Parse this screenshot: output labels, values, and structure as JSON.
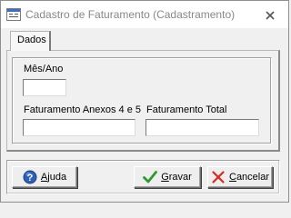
{
  "window": {
    "title": "Cadastro de Faturamento (Cadastramento)"
  },
  "tabs": [
    {
      "label": "Dados",
      "active": true
    }
  ],
  "form": {
    "mes_ano": {
      "label": "Mês/Ano",
      "value": ""
    },
    "faturamento_anexos": {
      "label": "Faturamento Anexos 4 e 5",
      "value": ""
    },
    "faturamento_total": {
      "label": "Faturamento Total",
      "value": ""
    }
  },
  "buttons": {
    "ajuda": {
      "accel": "A",
      "rest": "juda",
      "icon": "help-icon"
    },
    "gravar": {
      "accel": "G",
      "rest": "ravar",
      "icon": "checkmark-icon"
    },
    "cancelar": {
      "accel": "C",
      "rest": "ancelar",
      "icon": "cancel-x-icon"
    }
  },
  "colors": {
    "title_text": "#888888",
    "help_icon": "#2f5fb4",
    "check_icon": "#2e9a2e",
    "cancel_icon": "#d42a1c",
    "window_bg": "#f0f0f0"
  }
}
